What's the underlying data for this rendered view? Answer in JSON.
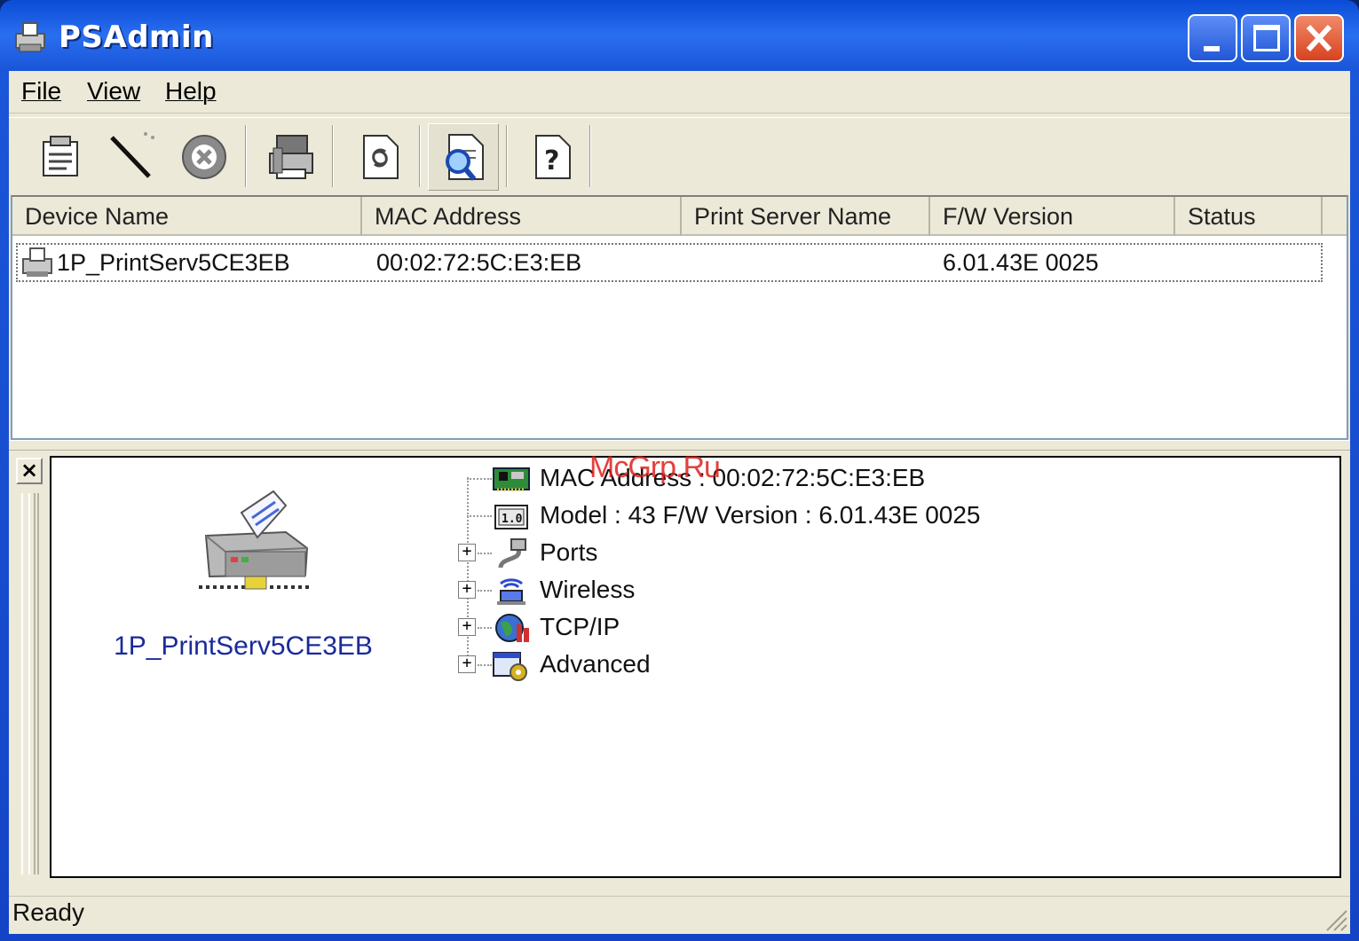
{
  "window": {
    "title": "PSAdmin"
  },
  "menu": [
    "File",
    "View",
    "Help"
  ],
  "toolbar": {
    "buttons": [
      {
        "name": "properties-icon"
      },
      {
        "name": "configure-wand-icon"
      },
      {
        "name": "stop-icon"
      },
      {
        "name": "printer-server-icon"
      },
      {
        "name": "refresh-icon"
      },
      {
        "name": "search-device-icon",
        "pressed": true
      },
      {
        "name": "help-icon"
      }
    ]
  },
  "list": {
    "columns": [
      "Device Name",
      "MAC Address",
      "Print Server Name",
      "F/W Version",
      "Status"
    ],
    "rows": [
      {
        "device_name": "1P_PrintServ5CE3EB",
        "mac": "00:02:72:5C:E3:EB",
        "server_name": "",
        "fw": "6.01.43E 0025",
        "status": ""
      }
    ]
  },
  "detail": {
    "device_caption": "1P_PrintServ5CE3EB",
    "tree": [
      {
        "label": "MAC Address : 00:02:72:5C:E3:EB",
        "icon": "network-card-icon",
        "expandable": false
      },
      {
        "label": "Model : 43   F/W Version : 6.01.43E 0025",
        "icon": "firmware-version-icon",
        "expandable": false
      },
      {
        "label": "Ports",
        "icon": "ports-icon",
        "expandable": true
      },
      {
        "label": "Wireless",
        "icon": "wireless-icon",
        "expandable": true
      },
      {
        "label": "TCP/IP",
        "icon": "tcpip-icon",
        "expandable": true
      },
      {
        "label": "Advanced",
        "icon": "advanced-icon",
        "expandable": true
      }
    ]
  },
  "watermark": "McGrp.Ru",
  "status": {
    "text": "Ready"
  },
  "colors": {
    "titlebar": "#0a4cd6",
    "client_bg": "#ece9d8",
    "caption_blue": "#1a2a9a",
    "close_red": "#d8431f"
  }
}
